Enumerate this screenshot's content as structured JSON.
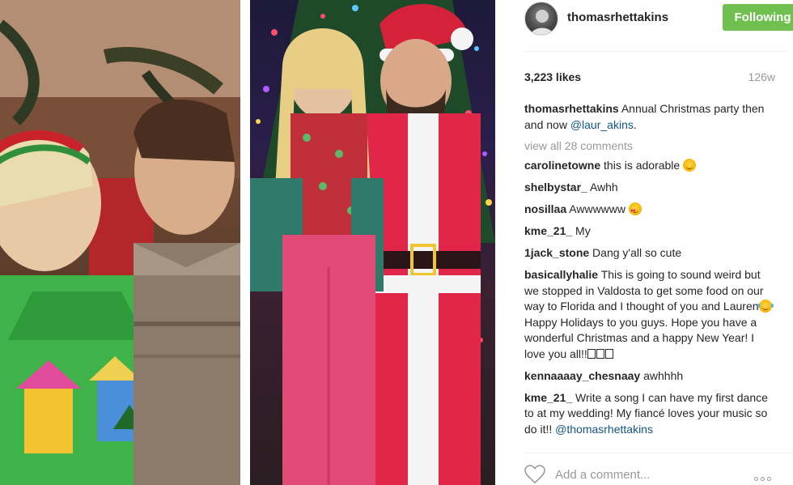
{
  "post": {
    "username": "thomasrhettakins",
    "follow_label": "Following",
    "likes": "3,223 likes",
    "age": "126w",
    "caption": {
      "user": "thomasrhettakins",
      "text": " Annual Christmas party then and now ",
      "mention": "@laur_akins",
      "end": "."
    },
    "view_all": "view all 28 comments",
    "comments": [
      {
        "user": "carolinetowne",
        "text": " this is adorable ",
        "emoji": "smile"
      },
      {
        "user": "shelbystar_",
        "text": " Awhh"
      },
      {
        "user": "nosillaa",
        "text": " Awwwwww ",
        "emoji": "heart-eyes"
      },
      {
        "user": "kme_21_",
        "text": " My"
      },
      {
        "user": "1jack_stone",
        "text": " Dang y'all so cute"
      },
      {
        "user": "basicallyhalie",
        "text": " This is going to sound weird but we stopped in Valdosta to get some food on our way to Florida and I thought of you and Lauren",
        "emoji": "tears-of-joy",
        "text2": "Happy Holidays to you guys. Hope you have a wonderful Christmas and a happy New Year! I love you all!!",
        "boxes": 3
      },
      {
        "user": "kennaaaay_chesnaay",
        "text": " awhhhh"
      },
      {
        "user": "kme_21_",
        "text": " Write a song I can have my first dance to at my wedding! My fiancé loves your music so do it!! ",
        "mention": "@thomasrhettakins"
      }
    ],
    "add_comment_placeholder": "Add a comment...",
    "colors": {
      "follow_button": "#70c050",
      "mention": "#125688",
      "muted": "#999999"
    },
    "icons": {
      "like": "heart-outline-icon",
      "more": "more-options-icon"
    }
  }
}
